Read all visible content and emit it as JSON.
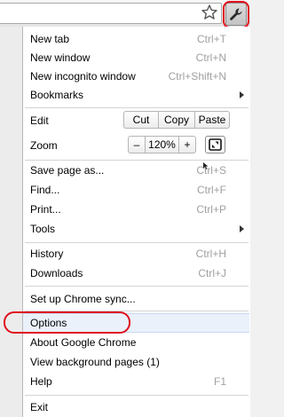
{
  "toolbar": {
    "star_icon": "star-icon",
    "wrench_icon": "wrench-icon"
  },
  "menu": {
    "items": [
      {
        "label": "New tab",
        "shortcut": "Ctrl+T"
      },
      {
        "label": "New window",
        "shortcut": "Ctrl+N"
      },
      {
        "label": "New incognito window",
        "shortcut": "Ctrl+Shift+N"
      },
      {
        "label": "Bookmarks",
        "submenu": true
      },
      {
        "label": "Edit"
      },
      {
        "label": "Zoom"
      },
      {
        "label": "Save page as...",
        "shortcut": "Ctrl+S"
      },
      {
        "label": "Find...",
        "shortcut": "Ctrl+F"
      },
      {
        "label": "Print...",
        "shortcut": "Ctrl+P"
      },
      {
        "label": "Tools",
        "submenu": true
      },
      {
        "label": "History",
        "shortcut": "Ctrl+H"
      },
      {
        "label": "Downloads",
        "shortcut": "Ctrl+J"
      },
      {
        "label": "Set up Chrome sync..."
      },
      {
        "label": "Options"
      },
      {
        "label": "About Google Chrome"
      },
      {
        "label": "View background pages (1)"
      },
      {
        "label": "Help",
        "shortcut": "F1"
      },
      {
        "label": "Exit"
      }
    ],
    "edit": {
      "cut": "Cut",
      "copy": "Copy",
      "paste": "Paste"
    },
    "zoom": {
      "minus": "–",
      "level": "120%",
      "plus": "+"
    }
  },
  "colors": {
    "highlight_ring": "#e0101c",
    "selected_item_bg": "#eaf1fb",
    "shortcut_text": "#a0a0a0"
  }
}
